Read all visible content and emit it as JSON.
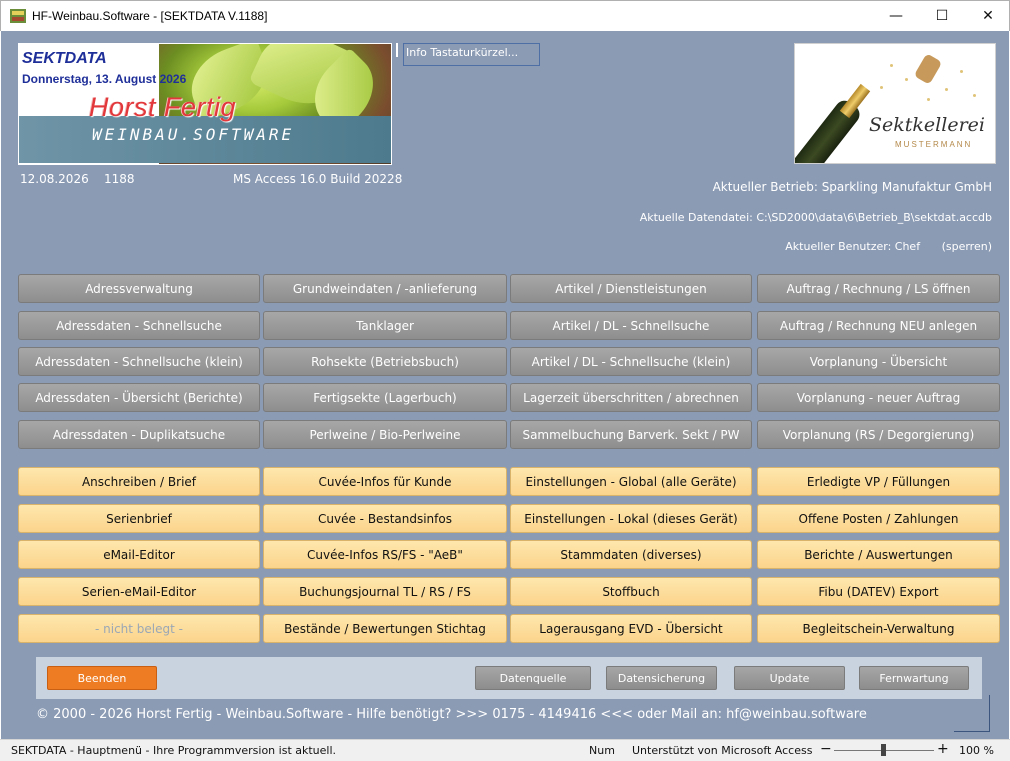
{
  "window": {
    "title": "HF-Weinbau.Software - [SEKTDATA V.1188]",
    "minimize": "—",
    "maximize": "☐",
    "close": "✕"
  },
  "banner": {
    "app_name": "SEKTDATA",
    "date": "Donnerstag, 13. August 2026",
    "brand_name": "Horst Fertig",
    "brand_sub": "WEINBAU.SOFTWARE"
  },
  "info_button": "Info Tastaturkürzel...",
  "logo": {
    "line1": "Sektkellerei",
    "line2": "MUSTERMANN"
  },
  "meta": {
    "date": "12.08.2026",
    "version": "1188",
    "access": "MS Access 16.0 Build 20228"
  },
  "info": {
    "betrieb": "Aktueller Betrieb: Sparkling Manufaktur GmbH",
    "datei": "Aktuelle Datendatei: C:\\SD2000\\data\\6\\Betrieb_B\\sektdat.accdb",
    "benutzer": "Aktueller Benutzer: Chef",
    "sperren": "(sperren)"
  },
  "grey_buttons": [
    [
      "Adressverwaltung",
      "Grundweindaten / -anlieferung",
      "Artikel / Dienstleistungen",
      "Auftrag / Rechnung / LS öffnen"
    ],
    [
      "Adressdaten - Schnellsuche",
      "Tanklager",
      "Artikel / DL - Schnellsuche",
      "Auftrag / Rechnung NEU anlegen"
    ],
    [
      "Adressdaten - Schnellsuche (klein)",
      "Rohsekte (Betriebsbuch)",
      "Artikel / DL - Schnellsuche (klein)",
      "Vorplanung - Übersicht"
    ],
    [
      "Adressdaten - Übersicht (Berichte)",
      "Fertigsekte (Lagerbuch)",
      "Lagerzeit überschritten / abrechnen",
      "Vorplanung - neuer Auftrag"
    ],
    [
      "Adressdaten - Duplikatsuche",
      "Perlweine / Bio-Perlweine",
      "Sammelbuchung Barverk. Sekt / PW",
      "Vorplanung (RS / Degorgierung)"
    ]
  ],
  "yellow_buttons": [
    [
      "Anschreiben / Brief",
      "Cuvée-Infos für Kunde",
      "Einstellungen - Global (alle Geräte)",
      "Erledigte VP / Füllungen"
    ],
    [
      "Serienbrief",
      "Cuvée - Bestandsinfos",
      "Einstellungen - Lokal (dieses Gerät)",
      "Offene Posten / Zahlungen"
    ],
    [
      "eMail-Editor",
      "Cuvée-Infos RS/FS - \"AeB\"",
      "Stammdaten (diverses)",
      "Berichte / Auswertungen"
    ],
    [
      "Serien-eMail-Editor",
      "Buchungsjournal TL / RS / FS",
      "Stoffbuch",
      "Fibu (DATEV) Export"
    ],
    [
      "- nicht belegt -",
      "Bestände / Bewertungen Stichtag",
      "Lagerausgang EVD - Übersicht",
      "Begleitschein-Verwaltung"
    ]
  ],
  "footer": {
    "beenden": "Beenden",
    "datenquelle": "Datenquelle",
    "datensicherung": "Datensicherung",
    "update": "Update",
    "fernwartung": "Fernwartung",
    "copyright": "© 2000 - 2026 Horst Fertig - Weinbau.Software - Hilfe benötigt? >>> 0175 - 4149416 <<< oder Mail an: hf@weinbau.software"
  },
  "statusbar": {
    "message": "SEKTDATA - Hauptmenü - Ihre Programmversion ist aktuell.",
    "num": "Num",
    "ms": "Unterstützt von Microsoft Access",
    "zoom_minus": "−",
    "zoom_plus": "+",
    "zoom": "100 %",
    "zoom_level_percent": 100
  },
  "colors": {
    "background": "#8b9bb4",
    "grey_button": "#9a9a9a",
    "yellow_button": "#fcd996",
    "end_button": "#ee7c22",
    "banner_title": "#1f2f99",
    "brand_red": "#e2373b"
  }
}
